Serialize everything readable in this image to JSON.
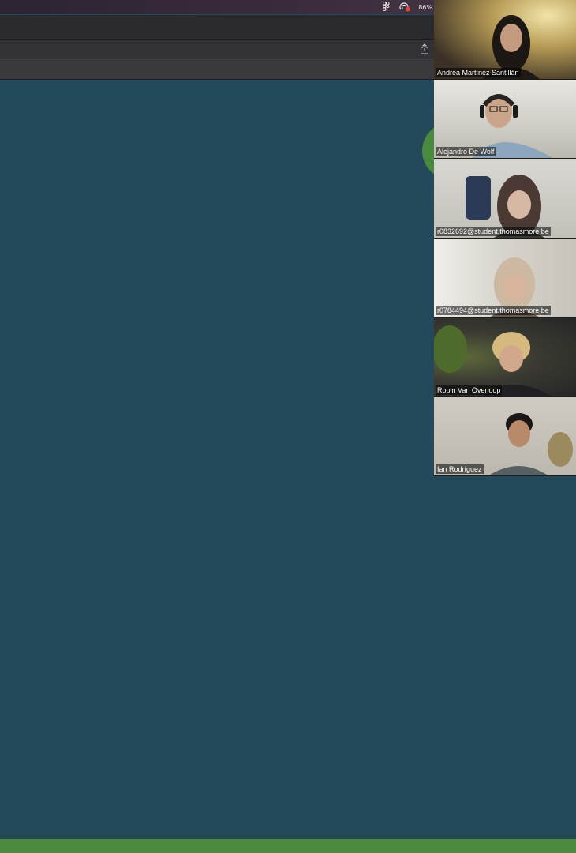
{
  "menubar": {
    "battery_label": "86%",
    "icons": [
      "figma-icon",
      "screen-record-icon"
    ]
  },
  "browser": {
    "share_icon": "share-icon"
  },
  "colors": {
    "page_background": "#24495b",
    "accent_green": "#4c8a3f"
  },
  "participants": [
    {
      "name": "Andrea Martínez Santillán"
    },
    {
      "name": "Alejandro De Wolf"
    },
    {
      "name": "r0832692@student.thomasmore.be"
    },
    {
      "name": "r0784494@student.thomasmore.be"
    },
    {
      "name": "Robin Van Overloop"
    },
    {
      "name": "Ian Rodríguez"
    }
  ]
}
